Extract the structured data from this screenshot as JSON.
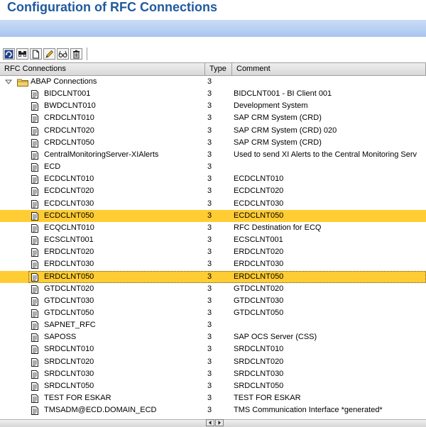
{
  "page": {
    "title": "Configuration of RFC Connections"
  },
  "toolbar": {
    "buttons": [
      {
        "icon": "refresh-icon"
      },
      {
        "icon": "find-icon"
      },
      {
        "icon": "create-icon"
      },
      {
        "icon": "change-icon"
      },
      {
        "icon": "display-icon"
      },
      {
        "icon": "delete-icon"
      }
    ]
  },
  "table": {
    "columns": [
      "RFC Connections",
      "Type",
      "Comment"
    ],
    "folder": {
      "name": "ABAP Connections",
      "type": "3",
      "expanded": true
    },
    "rows": [
      {
        "name": "BIDCLNT001",
        "type": "3",
        "comment": "BIDCLNT001 - BI Client 001"
      },
      {
        "name": "BWDCLNT010",
        "type": "3",
        "comment": "Development System"
      },
      {
        "name": "CRDCLNT010",
        "type": "3",
        "comment": "SAP CRM System (CRD)"
      },
      {
        "name": "CRDCLNT020",
        "type": "3",
        "comment": "SAP CRM System (CRD) 020"
      },
      {
        "name": "CRDCLNT050",
        "type": "3",
        "comment": "SAP CRM System (CRD)"
      },
      {
        "name": "CentralMonitoringServer-XIAlerts",
        "type": "3",
        "comment": "Used to send XI Alerts to the Central Monitoring Serv"
      },
      {
        "name": "ECD",
        "type": "3",
        "comment": ""
      },
      {
        "name": "ECDCLNT010",
        "type": "3",
        "comment": "ECDCLNT010"
      },
      {
        "name": "ECDCLNT020",
        "type": "3",
        "comment": "ECDCLNT020"
      },
      {
        "name": "ECDCLNT030",
        "type": "3",
        "comment": "ECDCLNT030"
      },
      {
        "name": "ECDCLNT050",
        "type": "3",
        "comment": "ECDCLNT050",
        "selected": true
      },
      {
        "name": "ECQCLNT010",
        "type": "3",
        "comment": "RFC Destination for ECQ"
      },
      {
        "name": "ECSCLNT001",
        "type": "3",
        "comment": "ECSCLNT001"
      },
      {
        "name": "ERDCLNT020",
        "type": "3",
        "comment": "ERDCLNT020"
      },
      {
        "name": "ERDCLNT030",
        "type": "3",
        "comment": "ERDCLNT030"
      },
      {
        "name": "ERDCLNT050",
        "type": "3",
        "comment": "ERDCLNT050",
        "selected": true,
        "focused": true
      },
      {
        "name": "GTDCLNT020",
        "type": "3",
        "comment": "GTDCLNT020"
      },
      {
        "name": "GTDCLNT030",
        "type": "3",
        "comment": "GTDCLNT030"
      },
      {
        "name": "GTDCLNT050",
        "type": "3",
        "comment": "GTDCLNT050"
      },
      {
        "name": "SAPNET_RFC",
        "type": "3",
        "comment": ""
      },
      {
        "name": "SAPOSS",
        "type": "3",
        "comment": "SAP OCS Server (CSS)"
      },
      {
        "name": "SRDCLNT010",
        "type": "3",
        "comment": "SRDCLNT010"
      },
      {
        "name": "SRDCLNT020",
        "type": "3",
        "comment": "SRDCLNT020"
      },
      {
        "name": "SRDCLNT030",
        "type": "3",
        "comment": "SRDCLNT030"
      },
      {
        "name": "SRDCLNT050",
        "type": "3",
        "comment": "SRDCLNT050"
      },
      {
        "name": "TEST FOR ESKAR",
        "type": "3",
        "comment": "TEST FOR ESKAR"
      },
      {
        "name": "TMSADM@ECD.DOMAIN_ECD",
        "type": "3",
        "comment": "TMS Communication Interface  *generated*"
      }
    ]
  },
  "colors": {
    "title": "#1f5a9e",
    "selected_row": "#ffcc33",
    "header_bar": "#b9d1f2"
  }
}
